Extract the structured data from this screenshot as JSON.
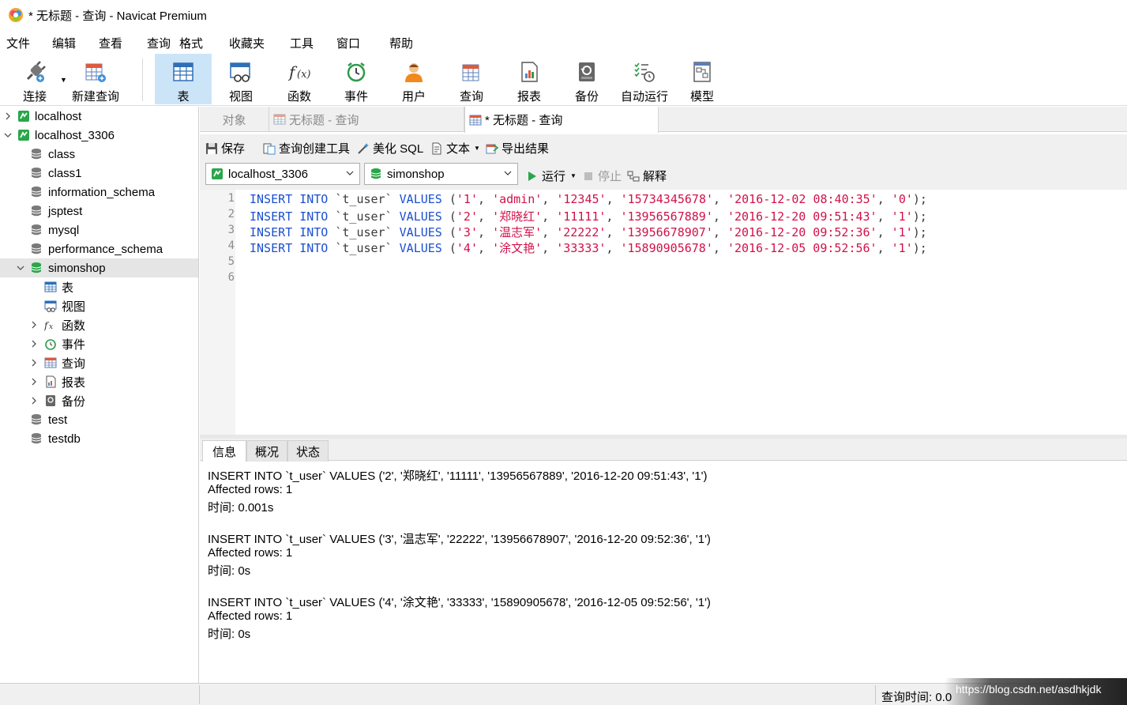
{
  "window": {
    "title": "* 无标题 - 查询 - Navicat Premium"
  },
  "menu": [
    "文件",
    "编辑",
    "查看",
    "查询",
    "格式",
    "收藏夹",
    "工具",
    "窗口",
    "帮助"
  ],
  "toolbar": {
    "connect": "连接",
    "new_query": "新建查询",
    "table": "表",
    "view": "视图",
    "function": "函数",
    "event": "事件",
    "user": "用户",
    "query": "查询",
    "report": "报表",
    "backup": "备份",
    "automation": "自动运行",
    "model": "模型"
  },
  "tree": {
    "conn1": "localhost",
    "conn2": "localhost_3306",
    "dbs_before": [
      "class",
      "class1",
      "information_schema",
      "jsptest",
      "mysql",
      "performance_schema"
    ],
    "selected_db": "simonshop",
    "children": [
      "表",
      "视图",
      "函数",
      "事件",
      "查询",
      "报表",
      "备份"
    ],
    "dbs_after": [
      "test",
      "testdb"
    ]
  },
  "tabs": {
    "objects": "对象",
    "inactive_query": "无标题 - 查询",
    "active_query": "* 无标题 - 查询"
  },
  "query_toolbar": {
    "save": "保存",
    "query_builder": "查询创建工具",
    "beautify": "美化 SQL",
    "text": "文本",
    "export": "导出结果"
  },
  "connbar": {
    "connection": "localhost_3306",
    "database": "simonshop",
    "run": "运行",
    "stop": "停止",
    "explain": "解释"
  },
  "editor": {
    "line_numbers": [
      "1",
      "2",
      "3",
      "4",
      "5",
      "6"
    ],
    "lines": [
      {
        "kw1": "INSERT INTO",
        "tbl": " `t_user` ",
        "kw2": "VALUES",
        "p_open": " (",
        "v": [
          "'1'",
          "'admin'",
          "'12345'",
          "'15734345678'",
          "'2016-12-02 08:40:35'",
          "'0'"
        ],
        "sep": ", ",
        "p_close": ");"
      },
      {
        "kw1": "INSERT INTO",
        "tbl": " `t_user` ",
        "kw2": "VALUES",
        "p_open": " (",
        "v": [
          "'2'",
          "'郑晓红'",
          "'11111'",
          "'13956567889'",
          "'2016-12-20 09:51:43'",
          "'1'"
        ],
        "sep": ", ",
        "p_close": ");"
      },
      {
        "kw1": "INSERT INTO",
        "tbl": " `t_user` ",
        "kw2": "VALUES",
        "p_open": " (",
        "v": [
          "'3'",
          "'温志军'",
          "'22222'",
          "'13956678907'",
          "'2016-12-20 09:52:36'",
          "'1'"
        ],
        "sep": ", ",
        "p_close": ");"
      },
      {
        "kw1": "INSERT INTO",
        "tbl": " `t_user` ",
        "kw2": "VALUES",
        "p_open": " (",
        "v": [
          "'4'",
          "'涂文艳'",
          "'33333'",
          "'15890905678'",
          "'2016-12-05 09:52:56'",
          "'1'"
        ],
        "sep": ", ",
        "p_close": ");"
      }
    ]
  },
  "result_tabs": [
    "信息",
    "概况",
    "状态"
  ],
  "messages": [
    "INSERT INTO `t_user` VALUES ('2', '郑晓红', '11111', '13956567889', '2016-12-20 09:51:43', '1')",
    "Affected rows: 1",
    "时间: 0.001s",
    "INSERT INTO `t_user` VALUES ('3', '温志军', '22222', '13956678907', '2016-12-20 09:52:36', '1')",
    "Affected rows: 1",
    "时间: 0s",
    "INSERT INTO `t_user` VALUES ('4', '涂文艳', '33333', '15890905678', '2016-12-05 09:52:56', '1')",
    "Affected rows: 1",
    "时间: 0s"
  ],
  "status": {
    "query_time": "查询时间: 0.0",
    "watermark": "https://blog.csdn.net/asdhkjdk"
  },
  "colors": {
    "keyword": "#1a4fd0",
    "string": "#d1114a",
    "selection": "#cce4f7",
    "db_green": "#2aa64a"
  }
}
